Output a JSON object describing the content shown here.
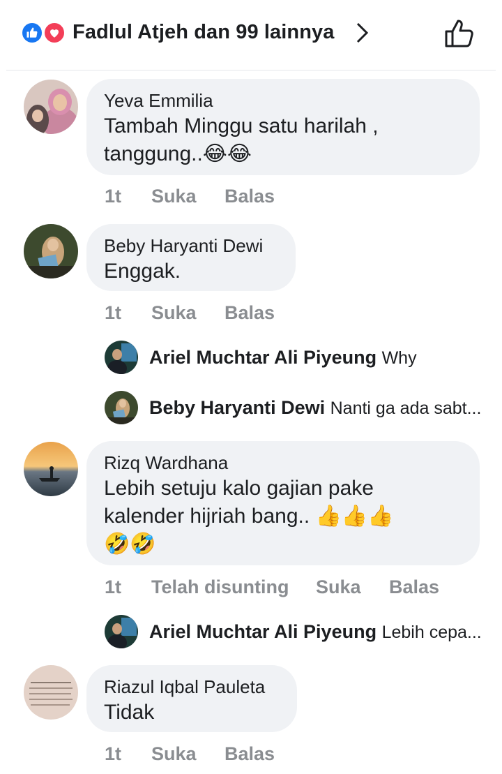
{
  "header": {
    "reactions": [
      "like-icon",
      "love-icon"
    ],
    "title": "Fadlul Atjeh dan 99 lainnya"
  },
  "colors": {
    "like": "#1877f2",
    "love": "#f33e58",
    "bubble": "#f0f2f5",
    "meta": "#8a8d91"
  },
  "comments": [
    {
      "author": "Yeva Emmilia",
      "line1": "Tambah Minggu satu harilah ,",
      "line2": "tanggung..",
      "line2_emoji": "😂😂",
      "time": "1t",
      "like": "Suka",
      "reply": "Balas"
    },
    {
      "author": "Beby Haryanti Dewi",
      "line1": "Enggak.",
      "time": "1t",
      "like": "Suka",
      "reply": "Balas",
      "replies": [
        {
          "author": "Ariel Muchtar Ali Piyeung",
          "text": "Why"
        },
        {
          "author": "Beby Haryanti Dewi",
          "text": "Nanti ga ada sabt..."
        }
      ]
    },
    {
      "author": "Rizq Wardhana",
      "line1": "Lebih setuju kalo gajian pake",
      "line2": "kalender hijriah bang..",
      "line2_emoji": " 👍👍👍",
      "line3_emoji": "🤣🤣",
      "time": "1t",
      "edited": "Telah disunting",
      "like": "Suka",
      "reply": "Balas",
      "replies": [
        {
          "author": "Ariel Muchtar Ali Piyeung",
          "text": "Lebih cepa..."
        }
      ]
    },
    {
      "author": "Riazul Iqbal Pauleta",
      "line1": "Tidak",
      "time": "1t",
      "like": "Suka",
      "reply": "Balas"
    }
  ]
}
